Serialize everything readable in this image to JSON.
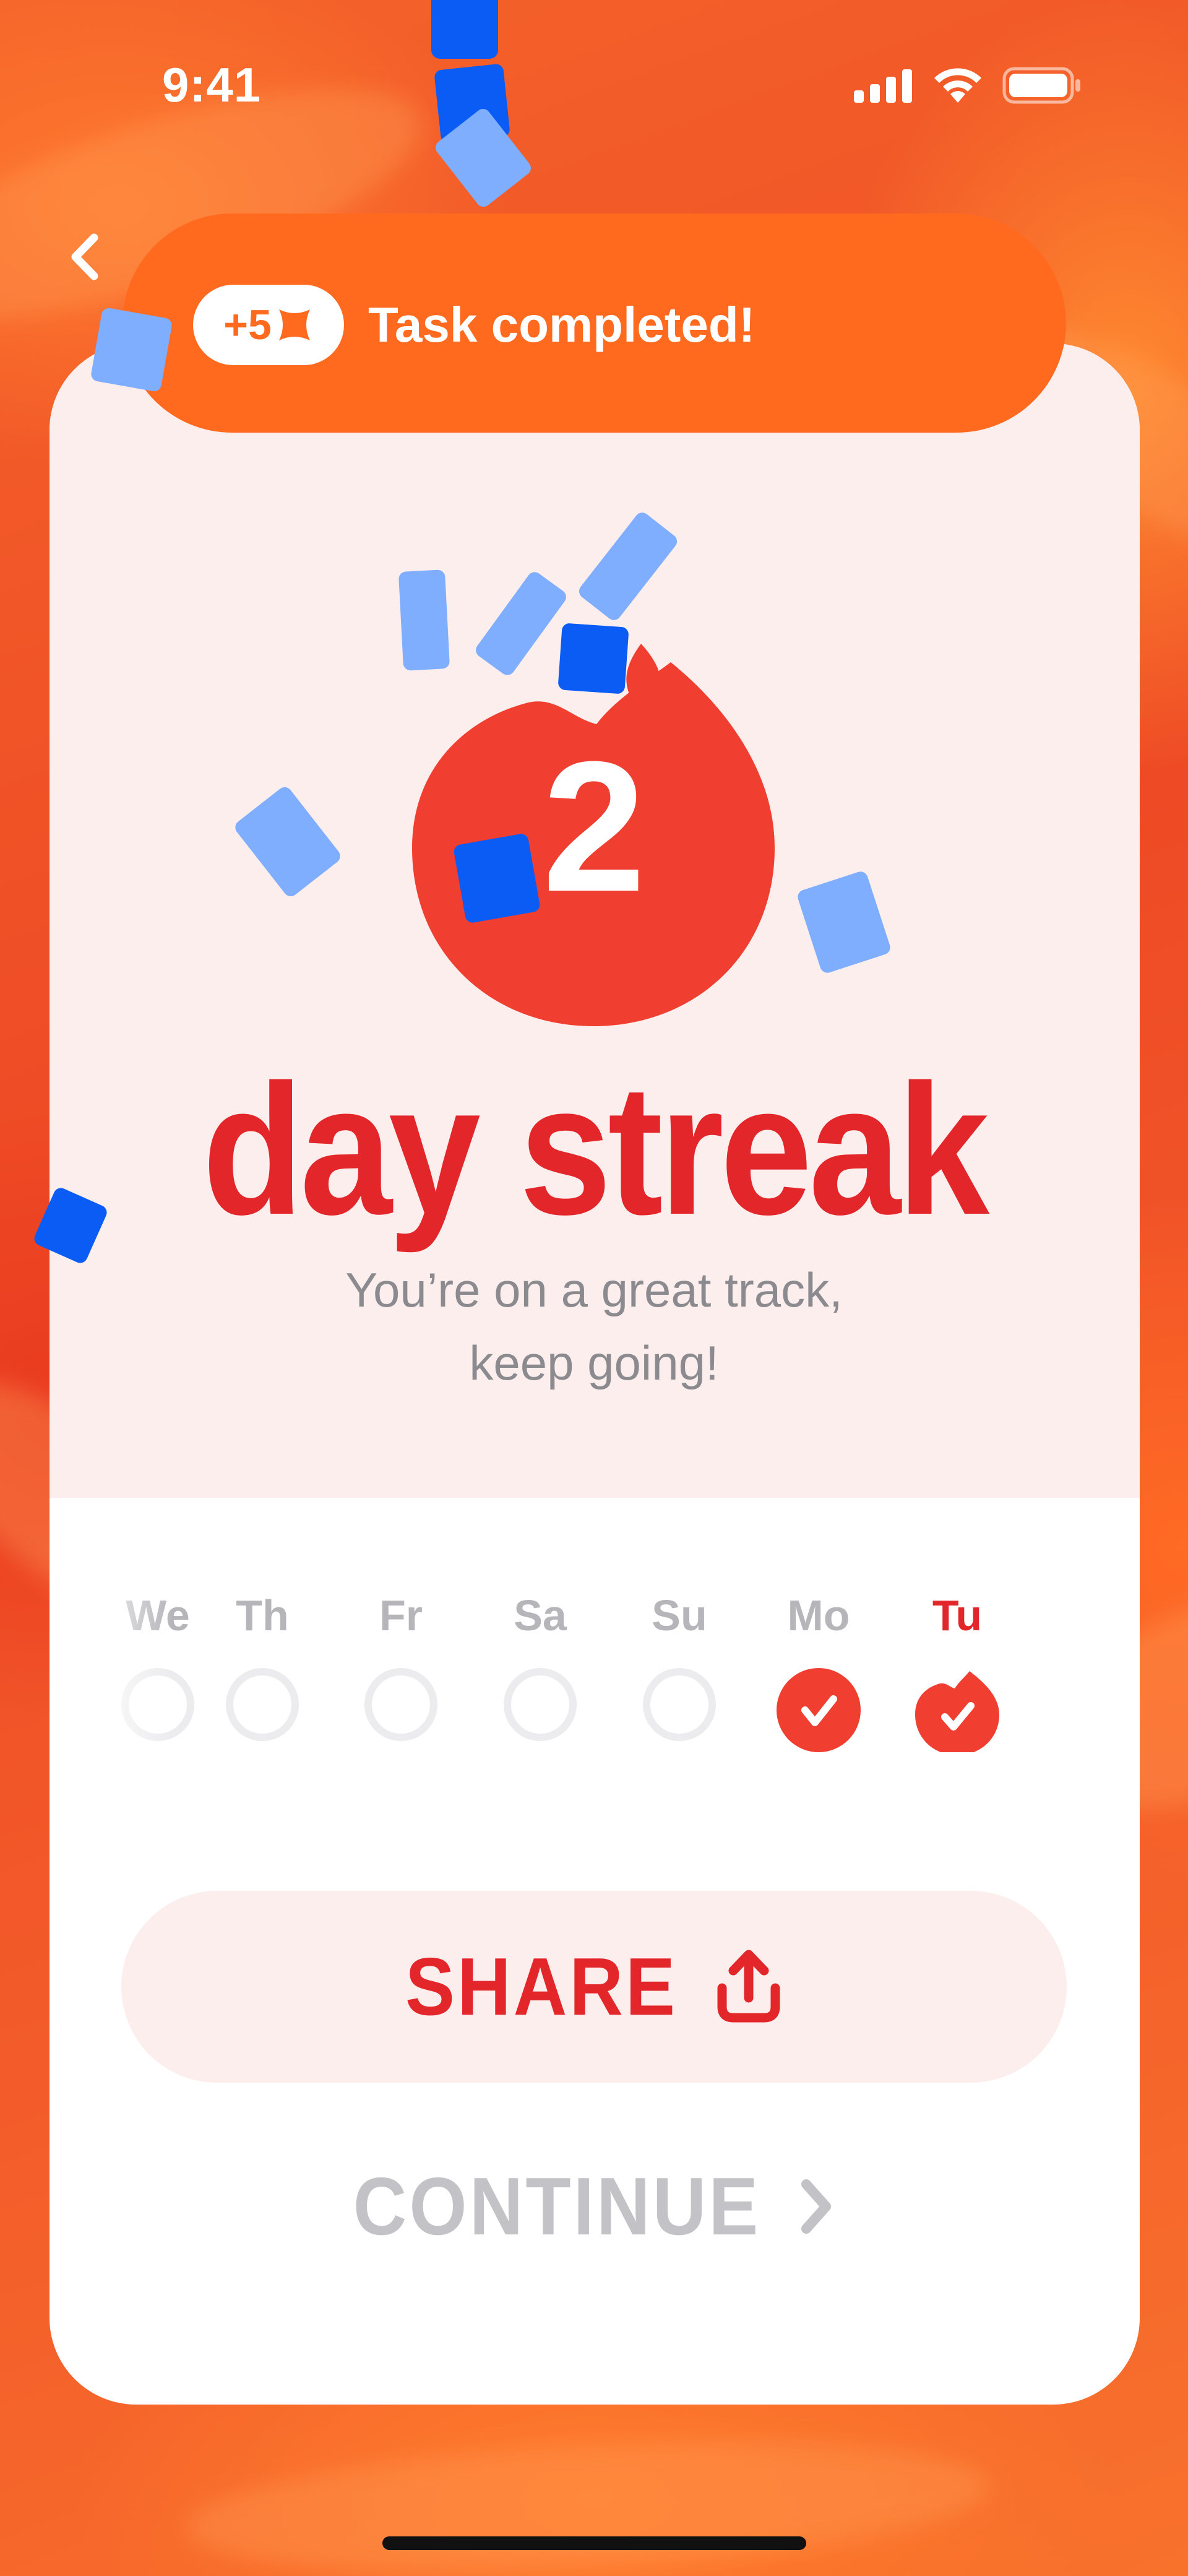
{
  "status_bar": {
    "time": "9:41"
  },
  "toast": {
    "points": "+5",
    "message": "Task completed!"
  },
  "streak": {
    "count": "2",
    "title": "day streak",
    "subtitle_line1": "You’re on a great track,",
    "subtitle_line2": "keep going!"
  },
  "week": {
    "days": [
      {
        "label": "We",
        "state": "empty"
      },
      {
        "label": "Th",
        "state": "empty"
      },
      {
        "label": "Fr",
        "state": "empty"
      },
      {
        "label": "Sa",
        "state": "empty"
      },
      {
        "label": "Su",
        "state": "empty"
      },
      {
        "label": "Mo",
        "state": "done"
      },
      {
        "label": "Tu",
        "state": "today"
      }
    ]
  },
  "actions": {
    "share_label": "SHARE",
    "continue_label": "CONTINUE"
  },
  "colors": {
    "accent": "#E3262A",
    "toast": "#FF6A1F",
    "confetti_light": "#7FAEFF",
    "confetti_dark": "#0A5CF5"
  }
}
